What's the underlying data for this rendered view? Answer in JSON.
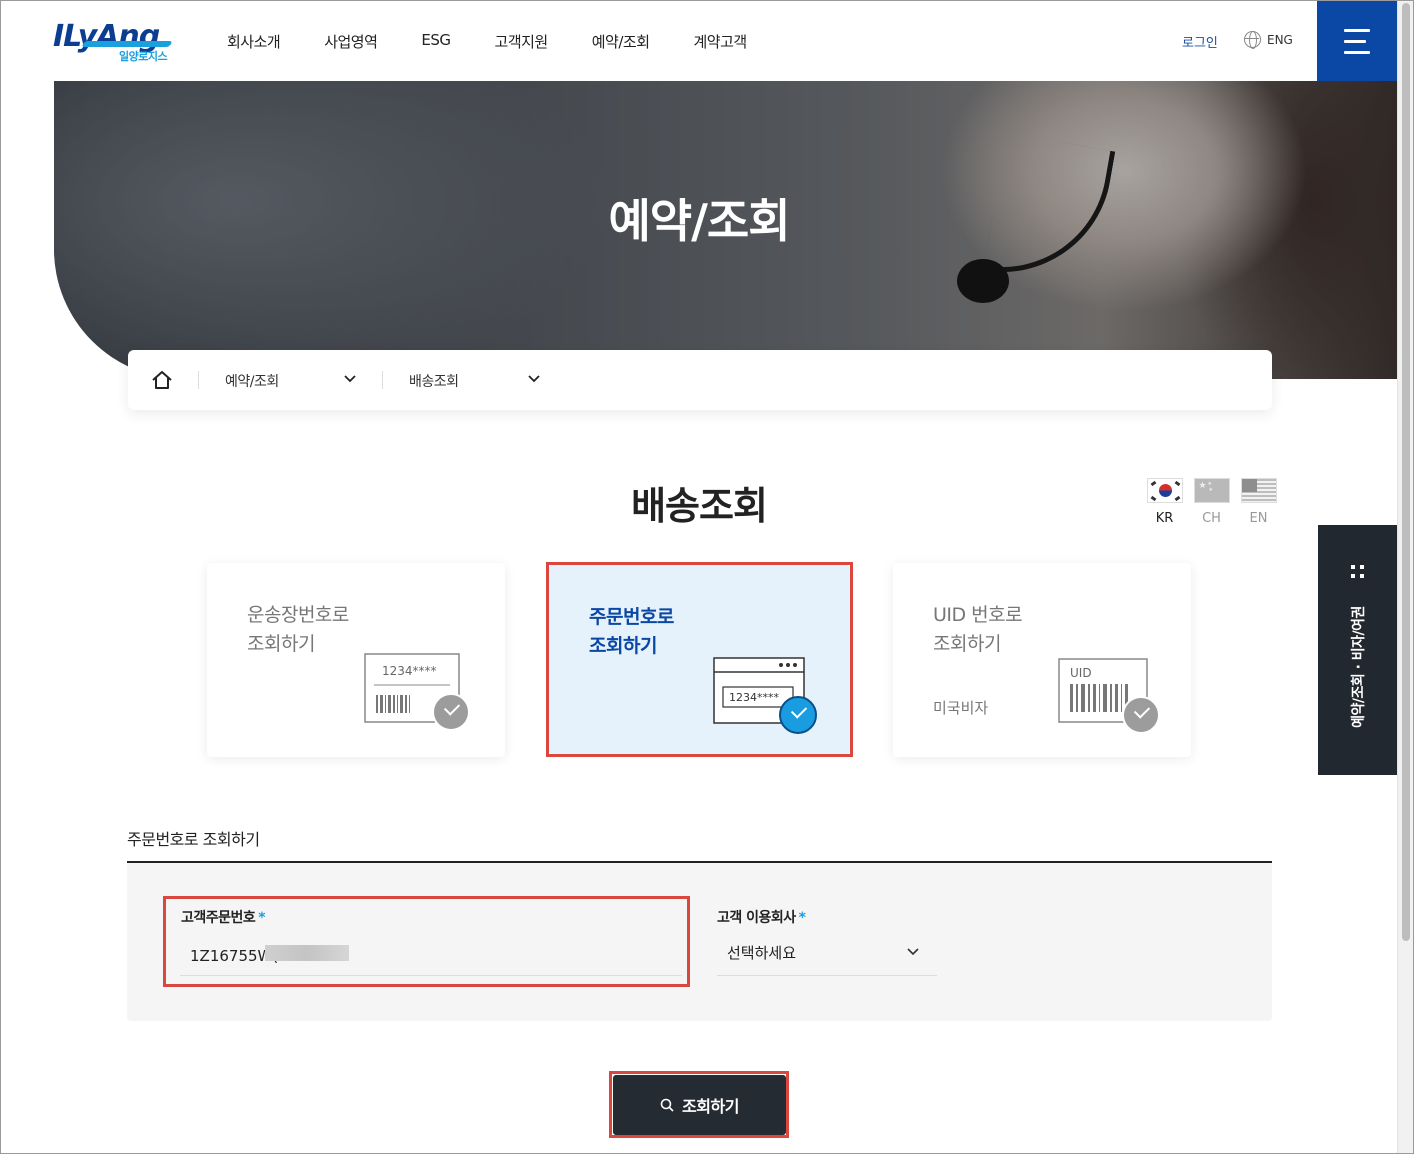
{
  "brand": {
    "logo_text": "ILyAng",
    "logo_sub": "일양로지스"
  },
  "nav": {
    "items": [
      "회사소개",
      "사업영역",
      "ESG",
      "고객지원",
      "예약/조회",
      "계약고객"
    ],
    "login": "로그인",
    "lang": "ENG"
  },
  "hero": {
    "title": "예약/조회"
  },
  "breadcrumb": {
    "level1": "예약/조회",
    "level2": "배송조회"
  },
  "section": {
    "title": "배송조회"
  },
  "languages": [
    {
      "label": "KR",
      "color": "#222222"
    },
    {
      "label": "CH",
      "color": "#999999"
    },
    {
      "label": "EN",
      "color": "#999999"
    }
  ],
  "cards": [
    {
      "title": "운송장번호로\n조회하기",
      "sub": "",
      "sample": "1234****",
      "selected": false
    },
    {
      "title": "주문번호로\n조회하기",
      "sub": "",
      "sample": "1234****",
      "selected": true
    },
    {
      "title": "UID 번호로\n조회하기",
      "sub": "미국비자",
      "sample": "UID",
      "selected": false
    }
  ],
  "form": {
    "heading": "주문번호로 조회하기",
    "order_label": "고객주문번호",
    "order_value": "1Z16755W(",
    "company_label": "고객 이용회사",
    "company_value": "선택하세요",
    "required_mark": "*"
  },
  "search_button": "조회하기",
  "side_tab": {
    "label": "예약/조회 · 비자/여권"
  },
  "colors": {
    "brand_blue": "#0b48a5",
    "accent": "#1a9ce0",
    "highlight": "#d9473f",
    "dark_button": "#252b33"
  }
}
